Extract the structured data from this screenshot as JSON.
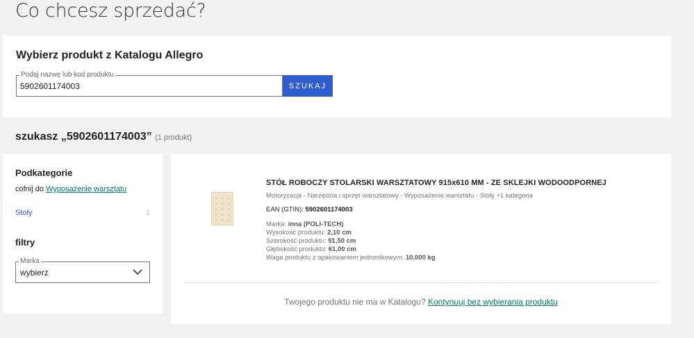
{
  "page": {
    "title": "Co chcesz sprzedać?"
  },
  "catalog": {
    "title": "Wybierz produkt z Katalogu Allegro",
    "search_label": "Podaj nazwę lub kod produktu",
    "search_value": "5902601174003",
    "search_button": "SZUKAJ"
  },
  "results": {
    "heading": "szukasz „5902601174003”",
    "count": "(1 produkt)"
  },
  "sidebar": {
    "subcategories_title": "Podkategorie",
    "back_prefix": "cofnij do",
    "back_link": "Wyposażenie warsztatu",
    "items": [
      {
        "label": "Stoły",
        "count": "1"
      }
    ],
    "filters_title": "filtry",
    "brand_label": "Marka",
    "brand_value": "wybierz"
  },
  "product": {
    "title": "STÓŁ ROBOCZY STOLARSKI WARSZTATOWY 915x610 MM - ZE SKLEJKI WODOODPORNEJ",
    "categories": "Motoryzacja - Narzędzia i sprzęt warsztatowy - Wyposażenie warsztatu - Stoły +1 kategoria",
    "ean_label": "EAN (GTIN):",
    "ean_value": "5902601174003",
    "attributes": [
      {
        "label": "Marka:",
        "value": "inna (POLI-TECH)"
      },
      {
        "label": "Wysokość produktu:",
        "value": "2,10 cm"
      },
      {
        "label": "Szerokość produktu:",
        "value": "91,50 cm"
      },
      {
        "label": "Głębokość produktu:",
        "value": "61,00 cm"
      },
      {
        "label": "Waga produktu z opakowaniem jednostkowym:",
        "value": "10,000 kg"
      }
    ]
  },
  "footer": {
    "text": "Twojego produktu nie ma w Katalogu?",
    "link": "Kontynuuj bez wybierania produktu"
  },
  "colors": {
    "accent": "#2f5dce",
    "link": "#00796b",
    "background": "#f2f2f2"
  },
  "icons": {
    "dropdown": "chevron-down-icon",
    "product_thumb": "product-image"
  }
}
